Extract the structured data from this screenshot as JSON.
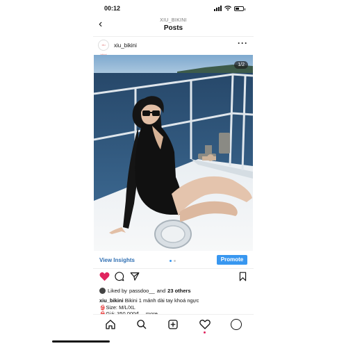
{
  "status_bar": {
    "time": "00:12",
    "location_arrow": "location-arrow-icon"
  },
  "nav": {
    "back_glyph": "‹",
    "subtitle": "XIU_BIKINI",
    "title": "Posts"
  },
  "post": {
    "avatar_text": "xiu bikini",
    "username": "xiu_bikini",
    "more_glyph": "···",
    "photo_counter": "1/2",
    "carousel_index": 1,
    "carousel_total": 2
  },
  "insights": {
    "link": "View Insights",
    "promote_label": "Promote"
  },
  "likes": {
    "prefix": "Liked by",
    "user": "passdoo__",
    "joiner": "and",
    "others": "23 others"
  },
  "caption": {
    "user": "xiu_bikini",
    "text": "Bikini 1 mảnh dài tay khoá ngực",
    "line2": "👙Size: M/L/XL",
    "line3": "👙Giá: 350.000đ ... more"
  },
  "colors": {
    "accent": "#3897f0",
    "heart": "#e0245e",
    "link": "#2f6fb3"
  },
  "tabbar": {
    "items": [
      "home-icon",
      "search-icon",
      "new-post-icon",
      "activity-heart-icon",
      "profile-icon"
    ]
  }
}
